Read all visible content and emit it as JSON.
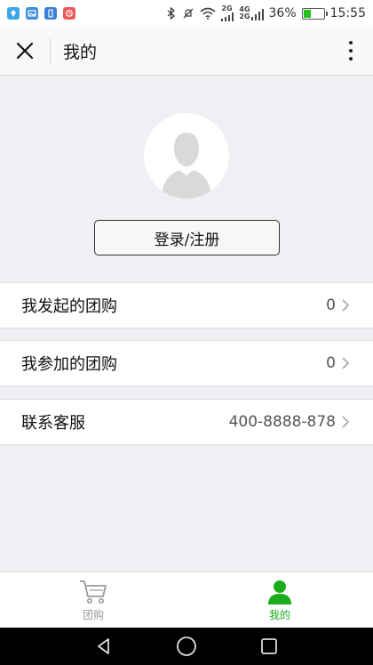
{
  "status_bar": {
    "battery_percent": "36%",
    "time": "15:55",
    "network_a": "2G",
    "network_b1": "4G",
    "network_b2": "2G",
    "battery_level": 0.36
  },
  "title_bar": {
    "title": "我的"
  },
  "profile": {
    "login_label": "登录/注册"
  },
  "menu": [
    {
      "label": "我发起的团购",
      "value": "0"
    },
    {
      "label": "我参加的团购",
      "value": "0"
    },
    {
      "label": "联系客服",
      "value": "400-8888-878"
    }
  ],
  "tabs": [
    {
      "label": "团购",
      "active": false
    },
    {
      "label": "我的",
      "active": true
    }
  ],
  "colors": {
    "accent_green": "#1aad19",
    "inactive_gray": "#999999",
    "background": "#efeff4"
  }
}
